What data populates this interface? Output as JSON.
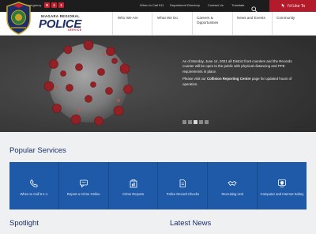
{
  "topbar": {
    "emergency_label": "Emergency",
    "emergency_digits": [
      "9",
      "1",
      "1"
    ],
    "links": [
      "When to Call 911",
      "Department Directory",
      "Contact Us",
      "Translate"
    ],
    "like_label": "I'd Like To",
    "search_icon": "search-icon"
  },
  "brand": {
    "line1": "NIAGARA REGIONAL",
    "line2": "POLICE",
    "line3": "SERVICE"
  },
  "nav": {
    "items": [
      "Who We Are",
      "What We Do",
      "Careers & Opportunities",
      "News and Events",
      "Community"
    ]
  },
  "hero": {
    "para1": "As of Monday, June 14, 2021 all District front counters and the Records counter will be open to the public with physical distancing and PPE requirements in place.",
    "para2_pre": "Please visit our ",
    "para2_link": "Collision Reporting Centre",
    "para2_post": " page for updated hours of operation.",
    "slide_count": 5,
    "active_slide": 3
  },
  "popular": {
    "title": "Popular Services",
    "items": [
      {
        "label": "When to Call 9-1-1",
        "icon": "phone-icon"
      },
      {
        "label": "Report a Crime Online",
        "icon": "chat-icon"
      },
      {
        "label": "Crime Reports",
        "icon": "report-icon"
      },
      {
        "label": "Police Record Checks",
        "icon": "document-icon"
      },
      {
        "label": "Recruiting Unit",
        "icon": "handshake-icon"
      },
      {
        "label": "Computer and Internet Safety",
        "icon": "shield-icon"
      }
    ]
  },
  "spotlight": {
    "title": "Spotlight"
  },
  "latest_news": {
    "title": "Latest News"
  },
  "colors": {
    "accent_red": "#b31b2a",
    "brand_navy": "#1c2f66",
    "services_blue": "#1f5aa8"
  }
}
